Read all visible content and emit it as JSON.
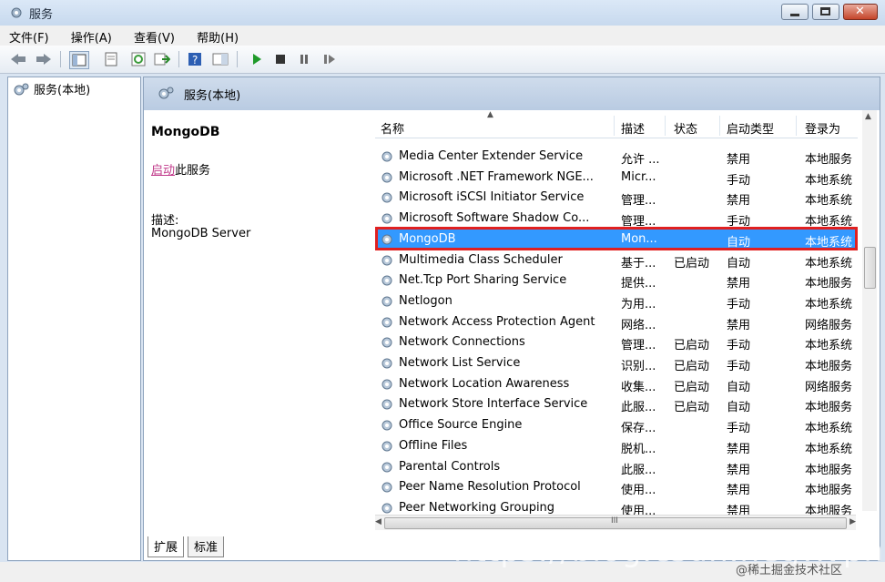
{
  "window": {
    "title": "服务"
  },
  "menu": [
    "文件(F)",
    "操作(A)",
    "查看(V)",
    "帮助(H)"
  ],
  "tree": {
    "root": "服务(本地)"
  },
  "header": {
    "title": "服务(本地)"
  },
  "detail": {
    "name": "MongoDB",
    "action_link": "启动",
    "action_suffix": "此服务",
    "desc_label": "描述:",
    "desc_value": "MongoDB Server"
  },
  "columns": [
    "名称",
    "描述",
    "状态",
    "启动类型",
    "登录为"
  ],
  "rows": [
    {
      "name": "Media Center Extender Service",
      "desc": "允许 ...",
      "status": "",
      "startup": "禁用",
      "logon": "本地服务"
    },
    {
      "name": "Microsoft .NET Framework NGE...",
      "desc": "Micr...",
      "status": "",
      "startup": "手动",
      "logon": "本地系统"
    },
    {
      "name": "Microsoft iSCSI Initiator Service",
      "desc": "管理...",
      "status": "",
      "startup": "禁用",
      "logon": "本地系统"
    },
    {
      "name": "Microsoft Software Shadow Co...",
      "desc": "管理...",
      "status": "",
      "startup": "手动",
      "logon": "本地系统"
    },
    {
      "name": "MongoDB",
      "desc": "Mon...",
      "status": "",
      "startup": "自动",
      "logon": "本地系统"
    },
    {
      "name": "Multimedia Class Scheduler",
      "desc": "基于...",
      "status": "已启动",
      "startup": "自动",
      "logon": "本地系统"
    },
    {
      "name": "Net.Tcp Port Sharing Service",
      "desc": "提供...",
      "status": "",
      "startup": "禁用",
      "logon": "本地服务"
    },
    {
      "name": "Netlogon",
      "desc": "为用...",
      "status": "",
      "startup": "手动",
      "logon": "本地系统"
    },
    {
      "name": "Network Access Protection Agent",
      "desc": "网络...",
      "status": "",
      "startup": "禁用",
      "logon": "网络服务"
    },
    {
      "name": "Network Connections",
      "desc": "管理...",
      "status": "已启动",
      "startup": "手动",
      "logon": "本地系统"
    },
    {
      "name": "Network List Service",
      "desc": "识别...",
      "status": "已启动",
      "startup": "手动",
      "logon": "本地服务"
    },
    {
      "name": "Network Location Awareness",
      "desc": "收集...",
      "status": "已启动",
      "startup": "自动",
      "logon": "网络服务"
    },
    {
      "name": "Network Store Interface Service",
      "desc": "此服...",
      "status": "已启动",
      "startup": "自动",
      "logon": "本地服务"
    },
    {
      "name": "Office Source Engine",
      "desc": "保存...",
      "status": "",
      "startup": "手动",
      "logon": "本地系统"
    },
    {
      "name": "Offline Files",
      "desc": "脱机...",
      "status": "",
      "startup": "禁用",
      "logon": "本地系统"
    },
    {
      "name": "Parental Controls",
      "desc": "此服...",
      "status": "",
      "startup": "禁用",
      "logon": "本地服务"
    },
    {
      "name": "Peer Name Resolution Protocol",
      "desc": "使用...",
      "status": "",
      "startup": "禁用",
      "logon": "本地服务"
    },
    {
      "name": "Peer Networking Grouping",
      "desc": "使用...",
      "status": "",
      "startup": "禁用",
      "logon": "本地服务"
    }
  ],
  "selected_row": "MongoDB",
  "tabs": [
    "扩展",
    "标准"
  ],
  "hscroll_label": "III",
  "watermark": "https://blog.csdn.net/xvpht",
  "watermark2": "@稀土掘金技术社区",
  "colors": {
    "selection": "#3399ff",
    "highlight_box": "#e02020",
    "link": "#c0398a"
  }
}
